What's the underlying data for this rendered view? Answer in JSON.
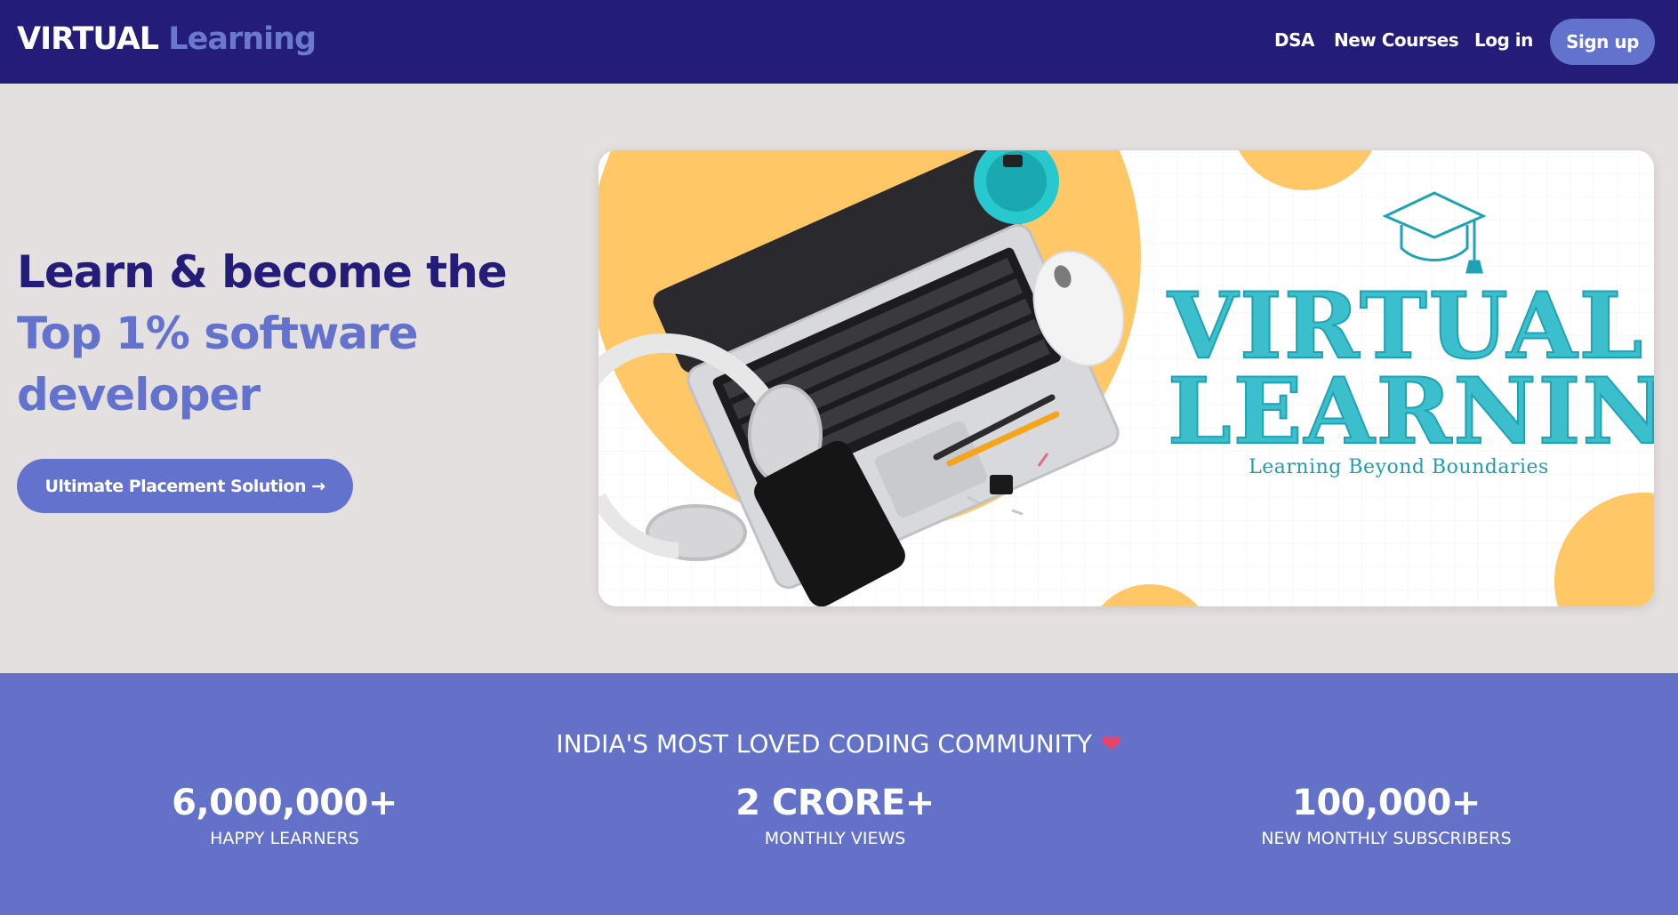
{
  "nav": {
    "logo_part1": "VIRTUAL",
    "logo_part2": "Learning",
    "links": [
      "DSA",
      "New Courses",
      "Log in"
    ],
    "signup": "Sign up"
  },
  "hero": {
    "line1": "Learn & become the",
    "line2": "Top 1% software",
    "line3": "developer",
    "cta": "Ultimate Placement Solution →"
  },
  "banner": {
    "title_line1": "VIRTUAL",
    "title_line2": "LEARNING",
    "subtitle": "Learning Beyond Boundaries"
  },
  "stats": {
    "heading": "INDIA'S MOST LOVED CODING COMMUNITY",
    "heart": "❤",
    "items": [
      {
        "value": "6,000,000+",
        "label": "HAPPY LEARNERS"
      },
      {
        "value": "2 CRORE+",
        "label": "MONTHLY VIEWS"
      },
      {
        "value": "100,000+",
        "label": "NEW MONTHLY SUBSCRIBERS"
      }
    ]
  },
  "colors": {
    "nav_bg": "#231c78",
    "accent": "#6372cc",
    "hero_bg": "#e5e0e0",
    "stats_bg": "#6372c8",
    "banner_orange": "#ffc766",
    "banner_teal": "#3bbfcc"
  }
}
